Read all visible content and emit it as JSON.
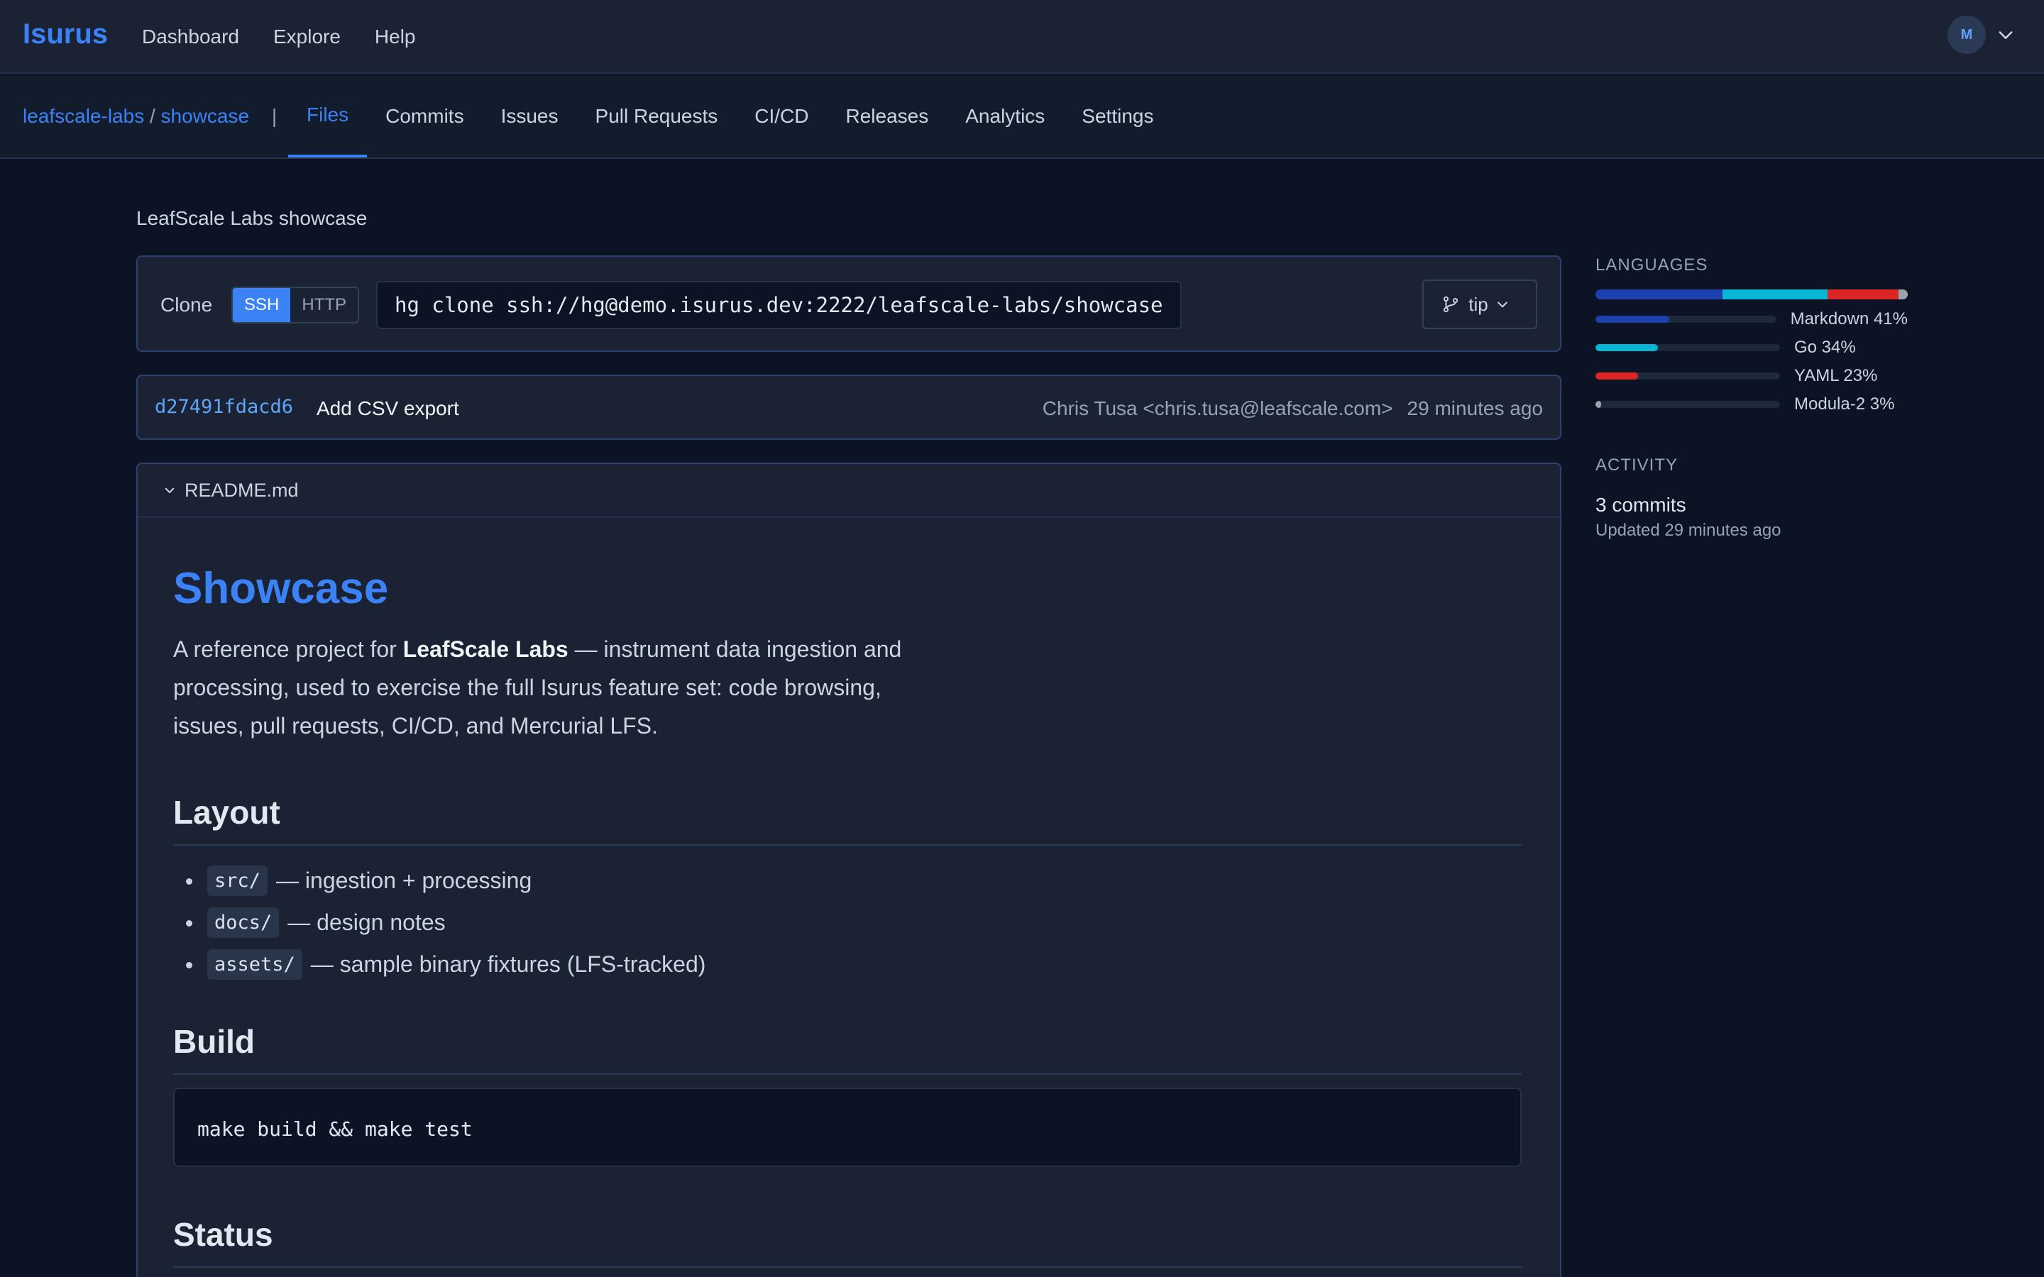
{
  "app": {
    "brand": "Isurus"
  },
  "topnav": {
    "items": [
      "Dashboard",
      "Explore",
      "Help"
    ]
  },
  "user": {
    "avatar_initial": "M"
  },
  "repo": {
    "owner": "leafscale-labs",
    "separator": "/",
    "name": "showcase",
    "pipe": "|",
    "description": "LeafScale Labs showcase"
  },
  "tabs": {
    "items": [
      "Files",
      "Commits",
      "Issues",
      "Pull Requests",
      "CI/CD",
      "Releases",
      "Analytics",
      "Settings"
    ],
    "active": "Files"
  },
  "clone": {
    "label": "Clone",
    "protocols": [
      "SSH",
      "HTTP"
    ],
    "active_protocol": "SSH",
    "url": "hg clone ssh://hg@demo.isurus.dev:2222/leafscale-labs/showcase",
    "branch": "tip"
  },
  "commit": {
    "hash": "d27491fdacd6",
    "message": "Add CSV export",
    "author": "Chris Tusa <chris.tusa@leafscale.com>",
    "time": "29 minutes ago"
  },
  "readme": {
    "filename": "README.md",
    "title": "Showcase",
    "intro_prefix": "A reference project for ",
    "intro_bold": "LeafScale Labs",
    "intro_suffix": " — instrument data ingestion and processing, used to exercise the full Isurus feature set: code browsing, issues, pull requests, CI/CD, and Mercurial LFS.",
    "layout_heading": "Layout",
    "layout_items": [
      {
        "code": "src/",
        "text": "— ingestion + processing"
      },
      {
        "code": "docs/",
        "text": "— design notes"
      },
      {
        "code": "assets/",
        "text": "— sample binary fixtures (LFS-tracked)"
      }
    ],
    "build_heading": "Build",
    "build_code": "make build && make test",
    "status_heading": "Status"
  },
  "sidebar": {
    "languages_title": "LANGUAGES",
    "languages": [
      {
        "name": "Markdown",
        "percent": 41,
        "label": "Markdown 41%",
        "color": "#1e40af"
      },
      {
        "name": "Go",
        "percent": 34,
        "label": "Go 34%",
        "color": "#06b6d4"
      },
      {
        "name": "YAML",
        "percent": 23,
        "label": "YAML 23%",
        "color": "#dc2626"
      },
      {
        "name": "Modula-2",
        "percent": 3,
        "label": "Modula-2 3%",
        "color": "#9ca3af"
      }
    ],
    "activity_title": "ACTIVITY",
    "commits": "3 commits",
    "updated": "Updated 29 minutes ago"
  }
}
